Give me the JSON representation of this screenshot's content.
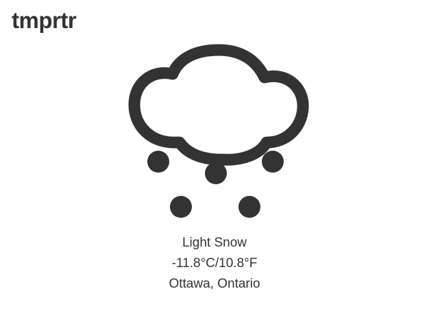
{
  "app": {
    "title": "tmprtr"
  },
  "weather": {
    "icon": "light-snow-icon",
    "condition": "Light Snow",
    "temperature": "-11.8°C/10.8°F",
    "location": "Ottawa, Ontario"
  },
  "colors": {
    "text": "#333333",
    "icon": "#333333",
    "background": "#ffffff"
  }
}
